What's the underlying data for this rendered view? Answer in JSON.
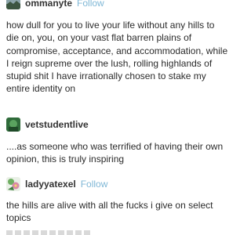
{
  "posts": [
    {
      "username": "ommanyte",
      "follow_label": "Follow",
      "text": "how dull for you to live your life without any hills to die on, you, on your vast flat barren plains of compromise, acceptance, and accommodation, while I reign supreme over the lush, rolling highlands of stupid shit I have irrationally chosen to stake my entire identity on",
      "avatar_icon": "landscape-avatar-icon"
    },
    {
      "username": "vetstudentlive",
      "text": "....as someone who was terrified of having their own opinion, this is truly inspiring",
      "avatar_icon": "green-avatar-icon"
    },
    {
      "username": "ladyyatexel",
      "follow_label": "Follow",
      "text": "the hills are alive with all the fucks i give on select topics",
      "avatar_icon": "floral-avatar-icon"
    }
  ],
  "colors": {
    "follow": "#7fb7d6",
    "text": "#2b2b2b",
    "username": "#333333"
  }
}
